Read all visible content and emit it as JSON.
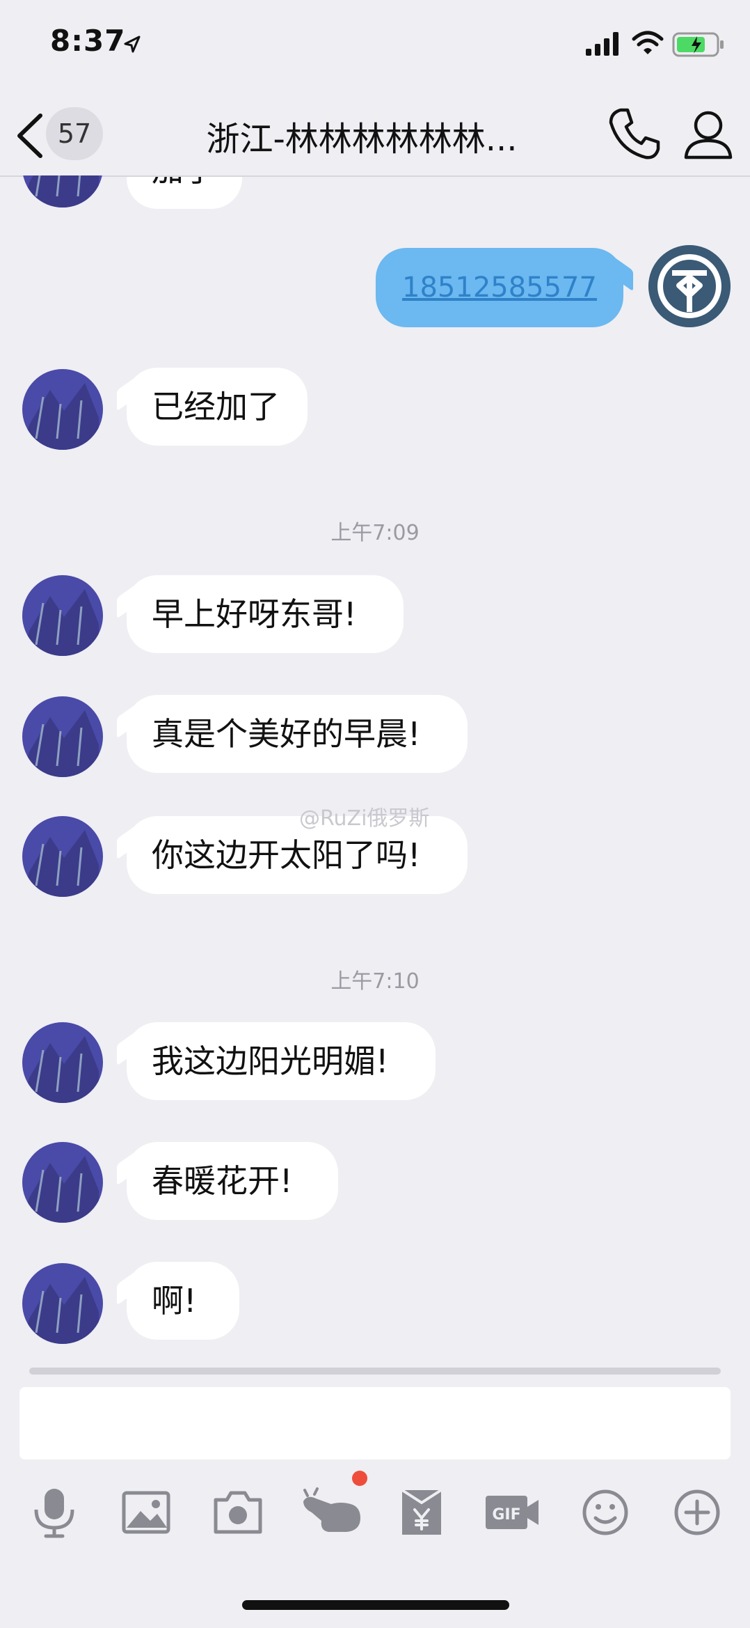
{
  "status_bar": {
    "time": "8:37"
  },
  "header": {
    "unread_count": "57",
    "title": "浙江-林林林林林林..."
  },
  "messages": {
    "partial_top": "加了",
    "sent_phone": "18512585577",
    "m1": "已经加了",
    "time1": "上午7:09",
    "m2": "早上好呀东哥!",
    "m3": "真是个美好的早晨!",
    "m4": "你这边开太阳了吗!",
    "time2": "上午7:10",
    "m5": "我这边阳光明媚!",
    "m6": "春暖花开!",
    "m7": "啊!"
  },
  "watermark": "@RuZi俄罗斯",
  "toolbar": {
    "icons": [
      "microphone-icon",
      "image-icon",
      "camera-icon",
      "poke-icon",
      "red-packet-icon",
      "gif-icon",
      "emoji-icon",
      "plus-icon"
    ],
    "poke_badge_color": "#ee4d3b"
  },
  "colors": {
    "background": "#eeeef3",
    "sent_bubble": "#6cb8f0",
    "received_bubble": "#ffffff"
  }
}
